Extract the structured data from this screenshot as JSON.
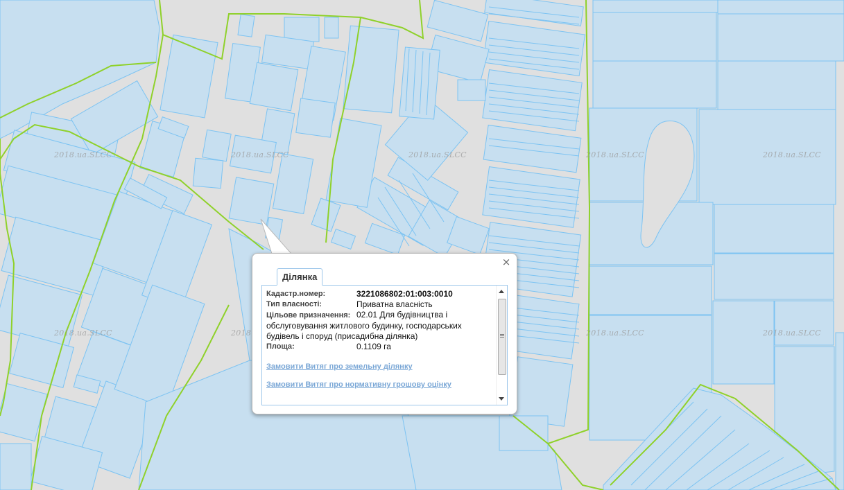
{
  "map": {
    "watermark": "2018.ua.SLCC",
    "colors": {
      "background": "#e0e0e0",
      "parcel_fill": "#c7dff0",
      "parcel_stroke": "#7cc3f2",
      "boundary": "#8fd12a"
    }
  },
  "popup": {
    "tab_label": "Ділянка",
    "close_icon": "×",
    "fields": [
      {
        "label": "Кадастр.номер:",
        "value": "3221086802:01:003:0010"
      },
      {
        "label": "Тип власності:",
        "value": "Приватна власність"
      },
      {
        "label": "Цільове призначення:",
        "value": "02.01 Для будівництва і обслуговування житлового будинку, господарських будівель і споруд (присадибна ділянка)"
      },
      {
        "label": "Площа:",
        "value": "0.1109 га"
      }
    ],
    "links": [
      "Замовити Витяг про земельну ділянку",
      "Замовити Витяг про нормативну грошову оцінку"
    ]
  }
}
